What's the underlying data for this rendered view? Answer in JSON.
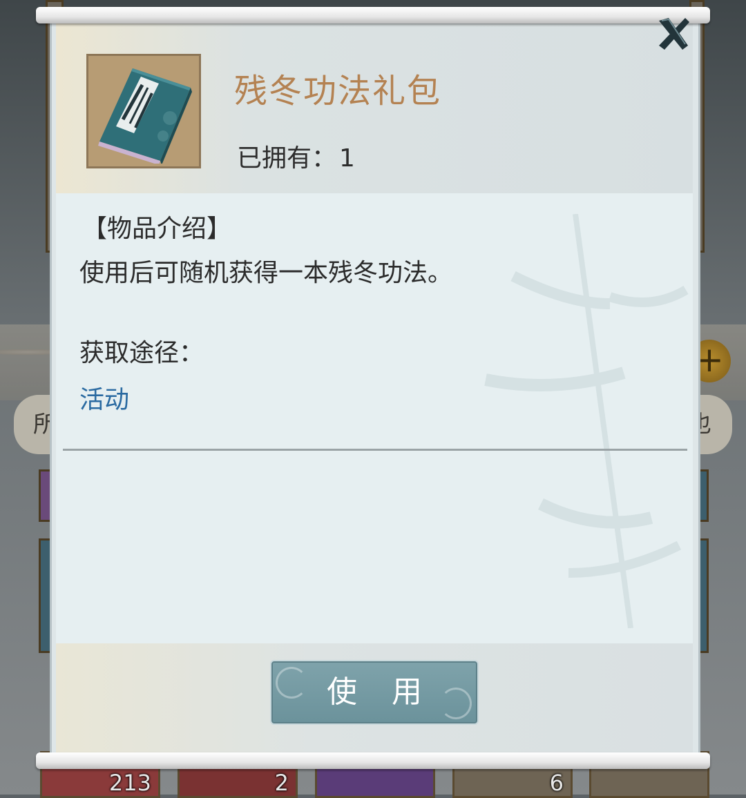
{
  "item": {
    "name": "残冬功法礼包",
    "owned_label": "已拥有：",
    "owned_count": "1"
  },
  "description": {
    "heading": "【物品介绍】",
    "text": "使用后可随机获得一本残冬功法。",
    "source_heading": "获取途径：",
    "source_link": "活动"
  },
  "actions": {
    "use_label": "使 用",
    "close_icon": "close-icon"
  },
  "background": {
    "left_tab": "所",
    "right_tab": "也",
    "slot_counts": [
      "213",
      "2",
      "",
      "6",
      ""
    ]
  },
  "colors": {
    "item_name": "#b48252",
    "source_link": "#2a6aa1",
    "use_button": "#6b929b"
  }
}
